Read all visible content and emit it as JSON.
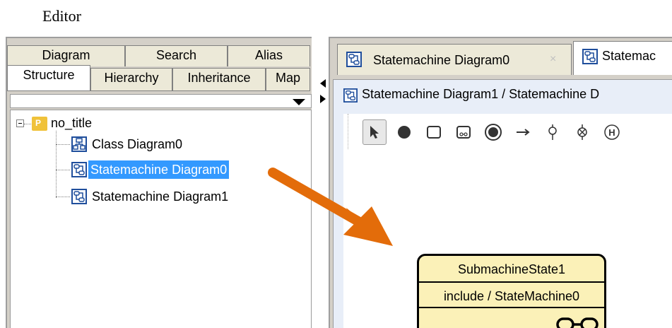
{
  "heading": "Editor",
  "left_panel": {
    "tabs_row1": [
      "Diagram",
      "Search",
      "Alias"
    ],
    "tabs_row2": [
      "Structure",
      "Hierarchy",
      "Inheritance",
      "Map"
    ],
    "tree": {
      "root": {
        "label": "no_title",
        "icon": "package-icon"
      },
      "children": [
        {
          "label": "Class Diagram0",
          "icon": "class-diagram-icon"
        },
        {
          "label": "Statemachine Diagram0",
          "icon": "statemachine-diagram-icon",
          "selected": true
        },
        {
          "label": "Statemachine Diagram1",
          "icon": "statemachine-diagram-icon"
        }
      ]
    }
  },
  "right_panel": {
    "doc_tabs": [
      {
        "label": "Statemachine Diagram0",
        "close": "×"
      },
      {
        "label": "Statemac",
        "active": true
      }
    ],
    "diagram_title": "Statemachine Diagram1 / Statemachine D",
    "toolbar": [
      "select-tool",
      "initial-state-tool",
      "state-tool",
      "submachine-state-tool",
      "final-state-tool",
      "transition-tool",
      "choice-tool",
      "junction-tool",
      "history-tool"
    ],
    "toolbar_history_label": "H",
    "state": {
      "name": "SubmachineState1",
      "body": "include / StateMachine0"
    }
  },
  "colors": {
    "selection": "#3399ff",
    "state_fill": "#fbf1b8",
    "arrow": "#e36c0a",
    "package": "#f0c23a"
  }
}
